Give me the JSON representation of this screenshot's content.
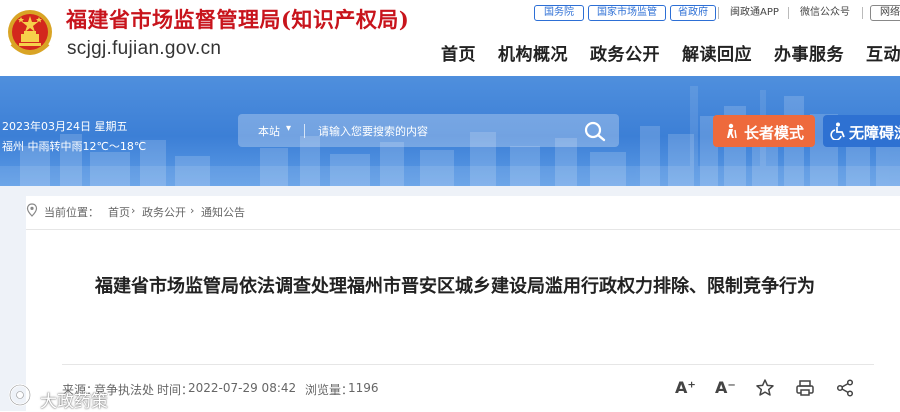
{
  "header": {
    "site_title": "福建省市场监督管理局(知识产权局)",
    "site_url": "scjgj.fujian.gov.cn",
    "top_links": {
      "state_council": "国务院",
      "national_market": "国家市场监管",
      "provincial_gov": "省政府",
      "minzheng_app": "闽政通APP",
      "wechat": "微信公众号",
      "network": "网络支"
    },
    "nav": [
      "首页",
      "机构概况",
      "政务公开",
      "解读回应",
      "办事服务",
      "互动"
    ]
  },
  "banner": {
    "date": "2023年03月24日 星期五",
    "weather": "福州 中雨转中雨12℃～18℃",
    "search_scope": "本站",
    "search_placeholder": "请输入您要搜索的内容",
    "elder_mode": "长者模式",
    "accessibility": "无障碍浏"
  },
  "breadcrumb": {
    "label": "当前位置：",
    "items": [
      "首页",
      "政务公开",
      "通知公告"
    ],
    "separator": "›"
  },
  "article": {
    "title": "福建省市场监管局依法调查处理福州市晋安区城乡建设局滥用行政权力排除、限制竞争行为",
    "source_label": "来源：",
    "source": "竞争执法处",
    "time_label": "时间：",
    "time": "2022-07-29 08:42",
    "views_label": "浏览量：",
    "views": "1196"
  },
  "toolbar": {
    "font_larger": "A⁺",
    "font_smaller": "A⁻"
  },
  "watermark": "大政药策",
  "colors": {
    "brand_red": "#c8141c",
    "primary_blue": "#2d6fd5",
    "banner_blue": "#3c7fd6",
    "elder_orange": "#ee6a3c",
    "page_bg": "#eef2f8"
  },
  "icons": {
    "emblem": "national-emblem-icon",
    "search": "search-icon",
    "elder": "elder-person-icon",
    "accessibility": "wheelchair-icon",
    "location": "location-pin-icon",
    "favorite": "star-icon",
    "print": "printer-icon",
    "share": "share-icon"
  }
}
